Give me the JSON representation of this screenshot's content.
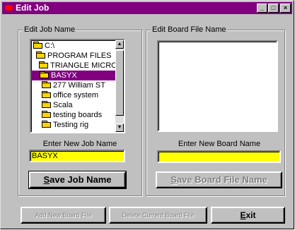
{
  "window": {
    "title": "Edit Job"
  },
  "title_buttons": {
    "minimize": "_",
    "maximize": "□",
    "close": "×"
  },
  "job_group": {
    "label": "Edit Job Name",
    "tree": [
      {
        "label": "C:\\",
        "selected": false
      },
      {
        "label": "PROGRAM FILES",
        "selected": false
      },
      {
        "label": "TRIANGLE MICROS",
        "selected": false
      },
      {
        "label": "BASYX",
        "selected": true
      },
      {
        "label": "277 William ST",
        "selected": false
      },
      {
        "label": "office system",
        "selected": false
      },
      {
        "label": "Scala",
        "selected": false
      },
      {
        "label": "testing boards",
        "selected": false
      },
      {
        "label": "Testing rig",
        "selected": false
      }
    ],
    "scroll": {
      "up": "▲",
      "down": "▼"
    },
    "new_name_label": "Enter New Job Name",
    "new_name_value": "BASYX",
    "save_button": "Save Job Name",
    "save_mnemonic": "S"
  },
  "board_group": {
    "label": "Edit Board File Name",
    "new_name_label": "Enter New Board Name",
    "new_name_value": "",
    "save_button": "Save  Board File Name",
    "save_mnemonic": "S"
  },
  "bottom_buttons": {
    "add_board": "Add New Board File",
    "delete_board": "Delete Current Board File",
    "exit": "Exit",
    "exit_mnemonic": "E"
  },
  "colors": {
    "titlebar": "#800080",
    "input_bg": "#ffff00",
    "selection": "#800080"
  }
}
